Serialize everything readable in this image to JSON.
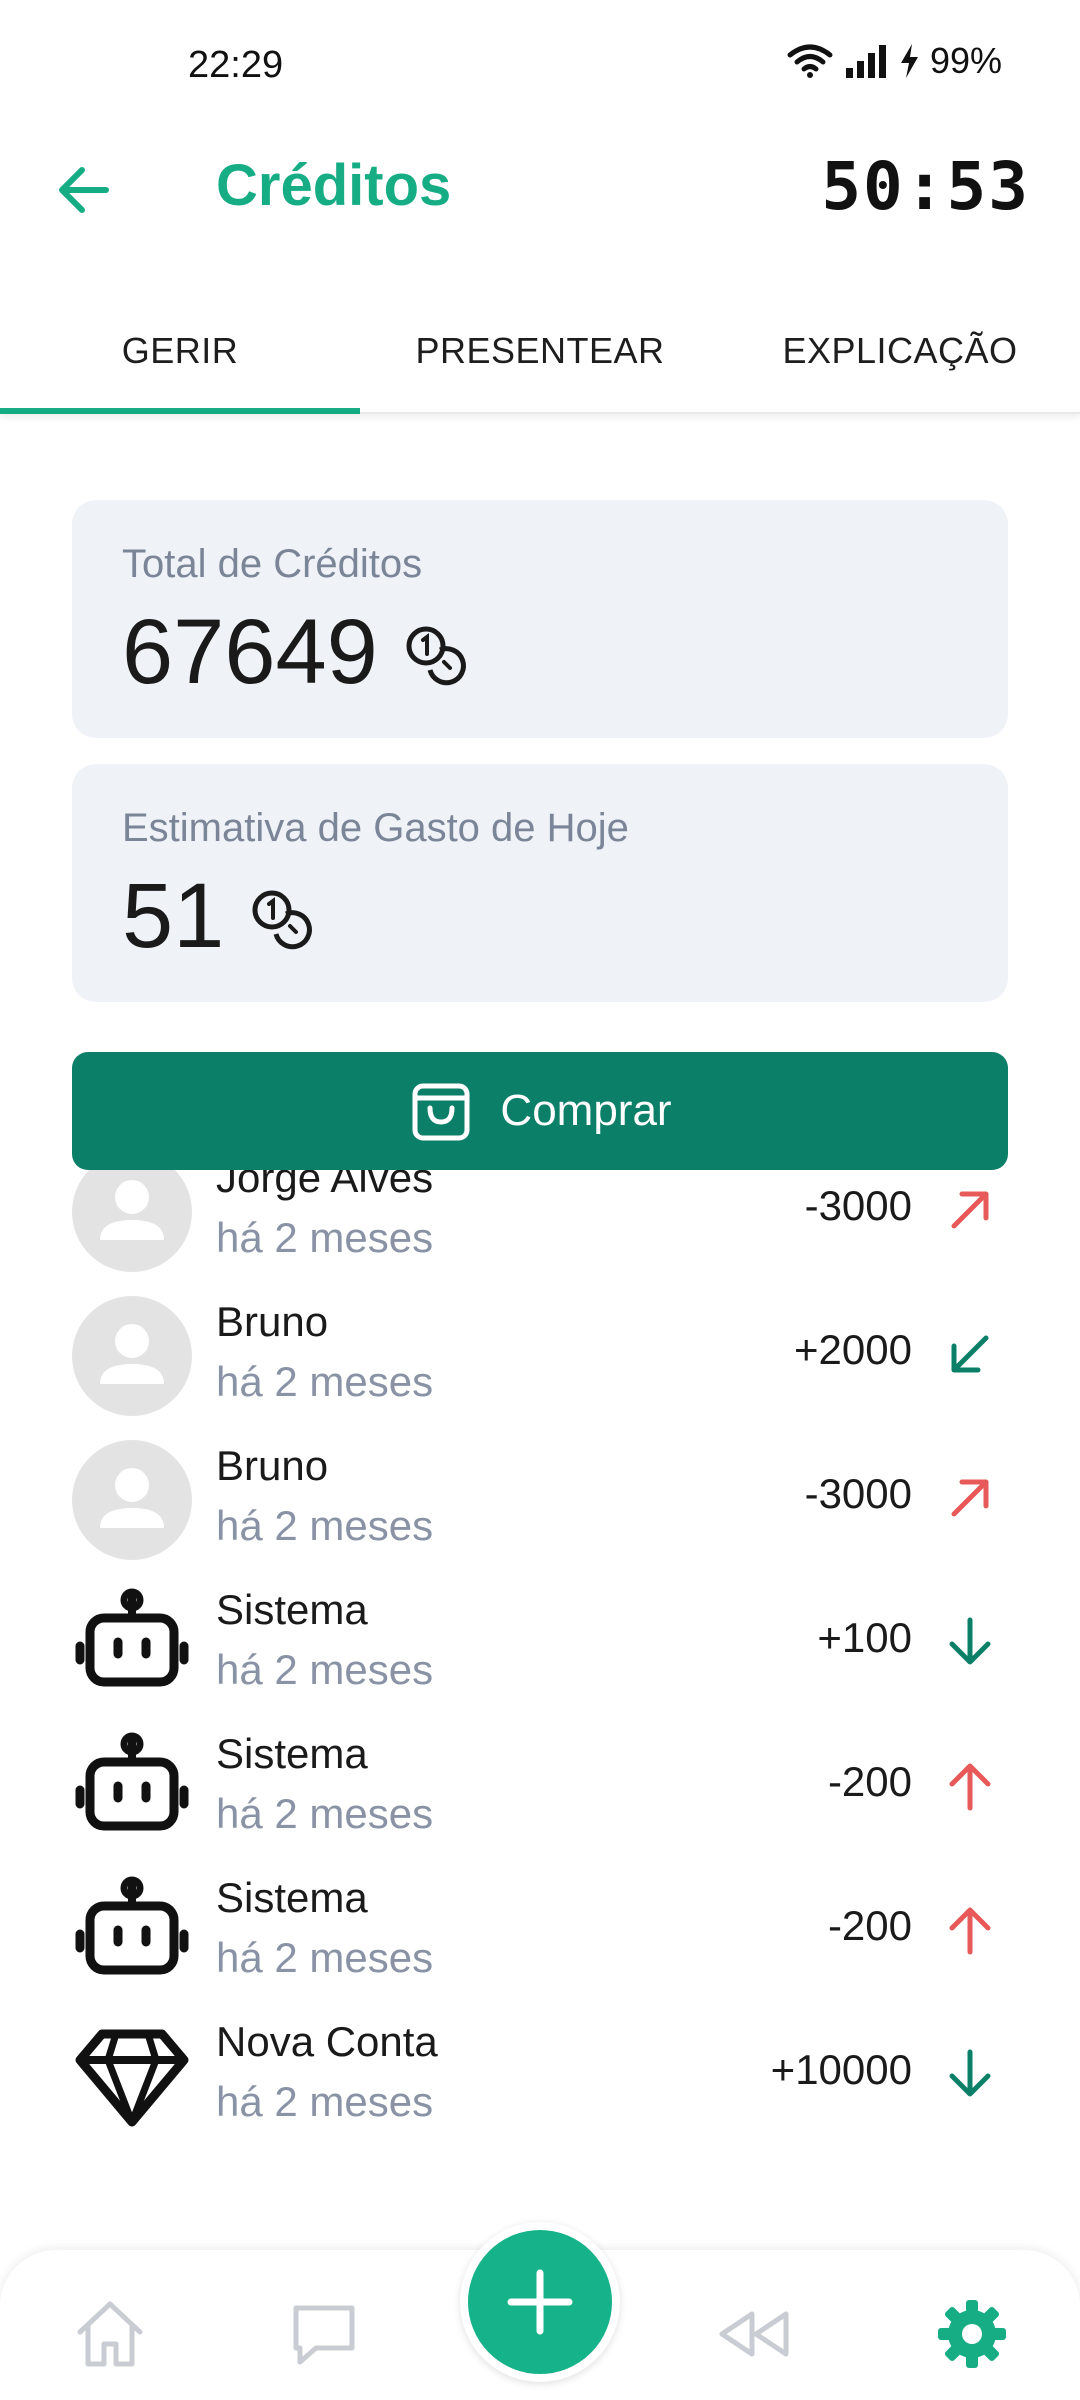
{
  "status_bar": {
    "time": "22:29",
    "battery": "99%"
  },
  "header": {
    "title": "Créditos",
    "timer": "50:53"
  },
  "tabs": [
    {
      "label": "GERIR",
      "active": true
    },
    {
      "label": "PRESENTEAR",
      "active": false
    },
    {
      "label": "EXPLICAÇÃO",
      "active": false
    }
  ],
  "total_card": {
    "label": "Total de Créditos",
    "value": "67649",
    "icon": "coins-icon"
  },
  "estimate_card": {
    "label": "Estimativa de Gasto de Hoje",
    "value": "51",
    "icon": "coins-icon"
  },
  "buy_button": {
    "label": "Comprar",
    "icon": "shopping-bag-icon"
  },
  "transactions": [
    {
      "name": "Jorge Alves",
      "time": "há 2 meses",
      "amount": "-3000",
      "avatar": "user-avatar",
      "direction": "out-diagonal"
    },
    {
      "name": "Bruno",
      "time": "há 2 meses",
      "amount": "+2000",
      "avatar": "user-avatar",
      "direction": "in-diagonal"
    },
    {
      "name": "Bruno",
      "time": "há 2 meses",
      "amount": "-3000",
      "avatar": "user-avatar",
      "direction": "out-diagonal"
    },
    {
      "name": "Sistema",
      "time": "há 2 meses",
      "amount": "+100",
      "avatar": "robot-icon",
      "direction": "in-down"
    },
    {
      "name": "Sistema",
      "time": "há 2 meses",
      "amount": "-200",
      "avatar": "robot-icon",
      "direction": "out-up"
    },
    {
      "name": "Sistema",
      "time": "há 2 meses",
      "amount": "-200",
      "avatar": "robot-icon",
      "direction": "out-up"
    },
    {
      "name": "Nova Conta",
      "time": "há 2 meses",
      "amount": "+10000",
      "avatar": "diamond-icon",
      "direction": "in-down"
    }
  ],
  "bottom_nav": [
    {
      "name": "home-icon",
      "active": false
    },
    {
      "name": "chat-icon",
      "active": false
    },
    {
      "name": "add-icon",
      "active": true
    },
    {
      "name": "rewind-icon",
      "active": false
    },
    {
      "name": "settings-icon",
      "active": true
    }
  ],
  "colors": {
    "accent": "#16ad85",
    "button": "#0b7f68",
    "negative": "#e85a5a",
    "positive": "#0b7f68",
    "card_bg": "#eff2f7"
  }
}
